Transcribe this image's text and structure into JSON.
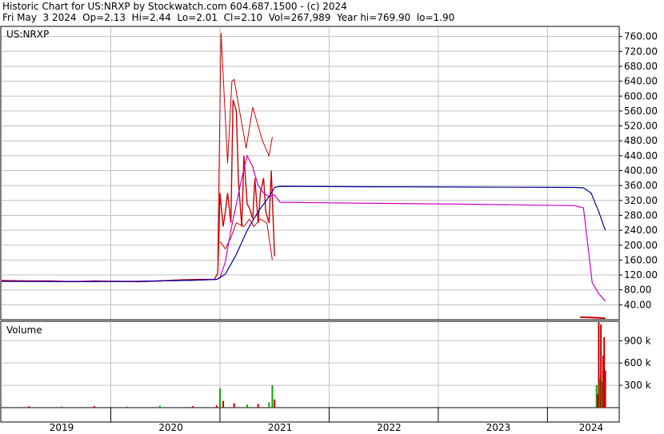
{
  "header": {
    "line1": "Historic Chart for US:NRXP by Stockwatch.com 604.687.1500 - (c) 2024",
    "line2": "Fri May  3 2024  Op=2.13  Hi=2.44  Lo=2.01  Cl=2.10  Vol=267,989  Year hi=769.90  lo=1.90"
  },
  "chart_data": [
    {
      "type": "line",
      "title": "US:NRXP",
      "y_ticks": [
        40,
        80,
        120,
        160,
        200,
        240,
        280,
        320,
        360,
        400,
        440,
        480,
        520,
        560,
        600,
        640,
        680,
        720,
        760
      ],
      "y_tick_labels": [
        "40.00",
        "80.00",
        "120.00",
        "160.00",
        "200.00",
        "240.00",
        "280.00",
        "320.00",
        "360.00",
        "400.00",
        "440.00",
        "480.00",
        "520.00",
        "560.00",
        "600.00",
        "640.00",
        "680.00",
        "720.00",
        "760.00"
      ],
      "ylim": [
        0,
        785
      ],
      "xlim": [
        2018.75,
        2024.4
      ],
      "x_tick_labels": [
        {
          "x": 2019.3,
          "label": "2019"
        },
        {
          "x": 2020.3,
          "label": "2020"
        },
        {
          "x": 2021.3,
          "label": "2021"
        },
        {
          "x": 2022.3,
          "label": "2022"
        },
        {
          "x": 2023.3,
          "label": "2023"
        },
        {
          "x": 2024.15,
          "label": "2024"
        }
      ],
      "colors": {
        "price": "#cc0000",
        "ma_short": "#cc00cc",
        "ma_long": "#000099",
        "grid": "#c0c0c0"
      },
      "series": [
        {
          "key": "price",
          "x": [
            2018.75,
            2019.0,
            2019.2,
            2019.4,
            2019.6,
            2019.8,
            2020.0,
            2020.2,
            2020.4,
            2020.6,
            2020.7,
            2020.73,
            2020.75,
            2020.78,
            2020.8,
            2020.82,
            2020.85,
            2020.87,
            2020.9,
            2020.92,
            2020.95,
            2020.97,
            2021.0,
            2021.02,
            2021.05,
            2021.07,
            2021.1,
            2021.12,
            2021.15,
            2021.17,
            2021.2,
            2021.22,
            2021.25
          ],
          "y": [
            105,
            104,
            104,
            102,
            104,
            103,
            102,
            104,
            107,
            108,
            108,
            125,
            340,
            250,
            290,
            340,
            260,
            590,
            560,
            370,
            250,
            440,
            310,
            300,
            270,
            380,
            260,
            340,
            380,
            290,
            260,
            400,
            170
          ]
        },
        {
          "key": "price_high",
          "x": [
            2020.73,
            2020.76,
            2020.82,
            2020.86,
            2020.88,
            2020.93,
            2020.99,
            2021.05,
            2021.09,
            2021.14,
            2021.2,
            2021.23
          ],
          "y": [
            160,
            770,
            420,
            640,
            645,
            560,
            460,
            570,
            530,
            480,
            440,
            490
          ]
        },
        {
          "key": "price_low",
          "x": [
            2020.75,
            2020.8,
            2020.85,
            2020.9,
            2020.97,
            2021.02,
            2021.06,
            2021.12,
            2021.18,
            2021.23
          ],
          "y": [
            210,
            190,
            220,
            260,
            250,
            270,
            250,
            270,
            260,
            160
          ]
        },
        {
          "key": "price_2024",
          "x": [
            2024.05,
            2024.15,
            2024.28
          ],
          "y": [
            7,
            6,
            4
          ]
        },
        {
          "key": "ma_short",
          "x": [
            2018.75,
            2019.5,
            2020.0,
            2020.5,
            2020.72,
            2020.75,
            2020.8,
            2020.85,
            2020.9,
            2020.95,
            2021.0,
            2021.05,
            2021.1,
            2021.15,
            2021.2,
            2021.25,
            2021.3,
            2022.0,
            2023.0,
            2024.0,
            2024.08,
            2024.12,
            2024.16,
            2024.22,
            2024.28
          ],
          "y": [
            103,
            103,
            103,
            106,
            108,
            112,
            155,
            240,
            310,
            380,
            440,
            410,
            360,
            340,
            330,
            335,
            315,
            313,
            310,
            306,
            300,
            200,
            100,
            70,
            50
          ]
        },
        {
          "key": "ma_long",
          "x": [
            2018.75,
            2019.5,
            2020.0,
            2020.5,
            2020.72,
            2020.8,
            2020.9,
            2021.0,
            2021.1,
            2021.2,
            2021.25,
            2021.3,
            2022.0,
            2023.0,
            2024.0,
            2024.08,
            2024.15,
            2024.22,
            2024.28
          ],
          "y": [
            103,
            102,
            103,
            106,
            108,
            122,
            175,
            240,
            290,
            330,
            355,
            358,
            357,
            356,
            355,
            354,
            340,
            290,
            240
          ]
        }
      ]
    },
    {
      "type": "bar",
      "title": "Volume",
      "ylabel": "",
      "y_ticks": [
        300000,
        600000,
        900000
      ],
      "y_tick_labels": [
        "300 k",
        "600 k",
        "900 k"
      ],
      "ylim": [
        0,
        1150000
      ],
      "xlim": [
        2018.75,
        2024.4
      ],
      "colors": {
        "up": "#00aa00",
        "down": "#cc0000"
      },
      "bars": [
        {
          "x": 2019.0,
          "v": 18000,
          "c": "down"
        },
        {
          "x": 2019.3,
          "v": 15000,
          "c": "up"
        },
        {
          "x": 2019.6,
          "v": 20000,
          "c": "down"
        },
        {
          "x": 2019.9,
          "v": 12000,
          "c": "down"
        },
        {
          "x": 2020.2,
          "v": 25000,
          "c": "up"
        },
        {
          "x": 2020.5,
          "v": 22000,
          "c": "down"
        },
        {
          "x": 2020.72,
          "v": 30000,
          "c": "down"
        },
        {
          "x": 2020.75,
          "v": 260000,
          "c": "up"
        },
        {
          "x": 2020.78,
          "v": 90000,
          "c": "down"
        },
        {
          "x": 2020.88,
          "v": 60000,
          "c": "down"
        },
        {
          "x": 2021.0,
          "v": 40000,
          "c": "up"
        },
        {
          "x": 2021.1,
          "v": 50000,
          "c": "down"
        },
        {
          "x": 2021.2,
          "v": 70000,
          "c": "up"
        },
        {
          "x": 2021.23,
          "v": 300000,
          "c": "up"
        },
        {
          "x": 2021.25,
          "v": 110000,
          "c": "down"
        },
        {
          "x": 2024.2,
          "v": 300000,
          "c": "up"
        },
        {
          "x": 2024.21,
          "v": 180000,
          "c": "down"
        },
        {
          "x": 2024.22,
          "v": 1150000,
          "c": "down"
        },
        {
          "x": 2024.23,
          "v": 400000,
          "c": "up"
        },
        {
          "x": 2024.24,
          "v": 1120000,
          "c": "down"
        },
        {
          "x": 2024.25,
          "v": 350000,
          "c": "up"
        },
        {
          "x": 2024.26,
          "v": 700000,
          "c": "down"
        },
        {
          "x": 2024.27,
          "v": 950000,
          "c": "down"
        },
        {
          "x": 2024.28,
          "v": 500000,
          "c": "down"
        }
      ]
    }
  ]
}
